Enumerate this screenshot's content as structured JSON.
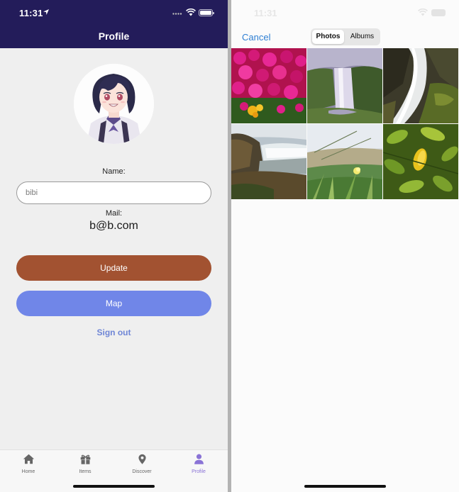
{
  "left_screen": {
    "status_bar": {
      "time": "11:31"
    },
    "header": {
      "title": "Profile"
    },
    "profile": {
      "name_label": "Name:",
      "name_value": "bibi",
      "mail_label": "Mail:",
      "mail_value": "b@b.com"
    },
    "buttons": {
      "update_label": "Update",
      "map_label": "Map",
      "signout_label": "Sign out"
    },
    "tab_bar": {
      "tabs": [
        {
          "label": "Home",
          "icon": "home-icon",
          "active": false
        },
        {
          "label": "Items",
          "icon": "gift-icon",
          "active": false
        },
        {
          "label": "Discover",
          "icon": "map-pin-icon",
          "active": false
        },
        {
          "label": "Profile",
          "icon": "person-icon",
          "active": true
        }
      ]
    }
  },
  "right_screen": {
    "status_bar": {
      "time": "11:31"
    },
    "picker": {
      "cancel_label": "Cancel",
      "segments": [
        "Photos",
        "Albums"
      ],
      "selected_segment": "Photos"
    },
    "photos": [
      {
        "subject": "pink-flowers"
      },
      {
        "subject": "waterfall-valley"
      },
      {
        "subject": "waterfall-rocks"
      },
      {
        "subject": "waterfall-cliff"
      },
      {
        "subject": "grass-closeup"
      },
      {
        "subject": "green-leaves"
      }
    ]
  },
  "colors": {
    "header_bg": "#231c5a",
    "update_button": "#a25231",
    "map_button": "#7086e8",
    "signout_link": "#6f86d6",
    "active_tab": "#8a73d6",
    "cancel_link": "#2f7fd3"
  }
}
